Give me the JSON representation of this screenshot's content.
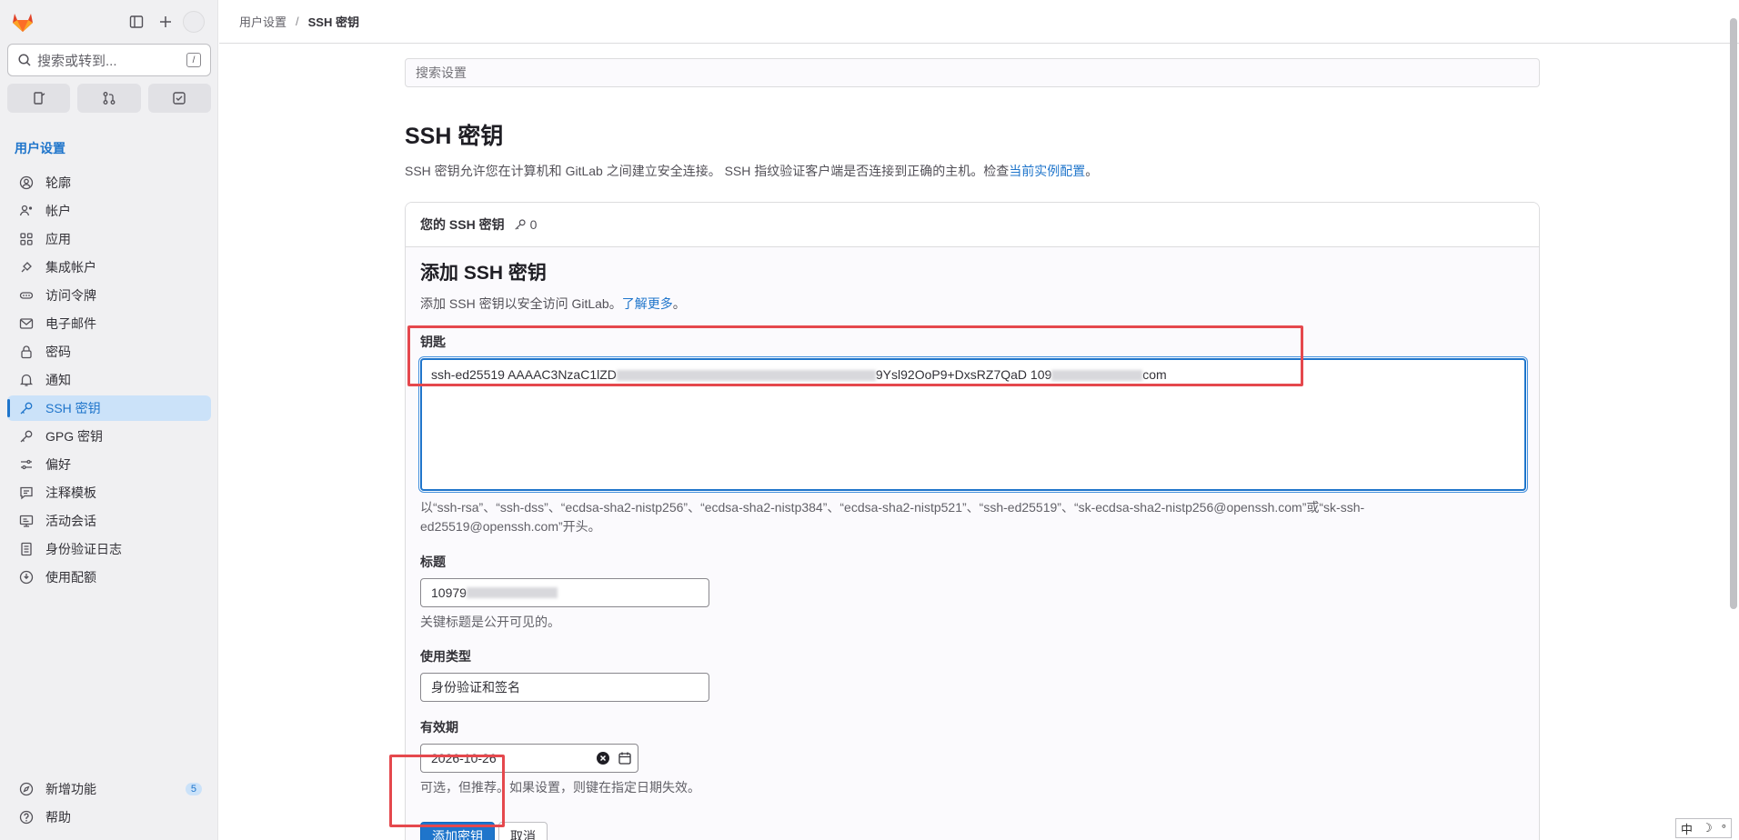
{
  "sidebar": {
    "search_placeholder": "搜索或转到...",
    "search_shortcut": "/",
    "section_title": "用户设置",
    "items": [
      {
        "label": "轮廓",
        "icon": "profile-icon"
      },
      {
        "label": "帐户",
        "icon": "account-icon"
      },
      {
        "label": "应用",
        "icon": "applications-icon"
      },
      {
        "label": "集成帐户",
        "icon": "chat-integration-icon"
      },
      {
        "label": "访问令牌",
        "icon": "token-icon"
      },
      {
        "label": "电子邮件",
        "icon": "mail-icon"
      },
      {
        "label": "密码",
        "icon": "lock-icon"
      },
      {
        "label": "通知",
        "icon": "notifications-icon"
      },
      {
        "label": "SSH 密钥",
        "icon": "key-icon",
        "active": true
      },
      {
        "label": "GPG 密钥",
        "icon": "key-icon"
      },
      {
        "label": "偏好",
        "icon": "preferences-icon"
      },
      {
        "label": "注释模板",
        "icon": "comment-templates-icon"
      },
      {
        "label": "活动会话",
        "icon": "sessions-icon"
      },
      {
        "label": "身份验证日志",
        "icon": "log-icon"
      },
      {
        "label": "使用配额",
        "icon": "quota-icon"
      }
    ],
    "whats_new": {
      "label": "新增功能",
      "badge": "5"
    },
    "help": {
      "label": "帮助"
    }
  },
  "breadcrumb": {
    "parent": "用户设置",
    "current": "SSH 密钥"
  },
  "settings_search_placeholder": "搜索设置",
  "page": {
    "title": "SSH 密钥",
    "desc_before": "SSH 密钥允许您在计算机和 GitLab 之间建立安全连接。 SSH 指纹验证客户端是否连接到正确的主机。检查",
    "desc_link": "当前实例配置",
    "desc_after": "。"
  },
  "card": {
    "header_title": "您的 SSH 密钥",
    "key_count": "0",
    "form_title": "添加 SSH 密钥",
    "form_desc": "添加 SSH 密钥以安全访问 GitLab。",
    "form_desc_link": "了解更多",
    "form_desc_after": "。",
    "key_label": "钥匙",
    "key_value_start": "ssh-ed25519 AAAAC3NzaC1lZD",
    "key_value_mid": "9Ysl92OoP9+DxsRZ7QaD 109",
    "key_value_end": "com",
    "key_hint": "以“ssh-rsa”、“ssh-dss”、“ecdsa-sha2-nistp256”、“ecdsa-sha2-nistp384”、“ecdsa-sha2-nistp521”、“ssh-ed25519”、“sk-ecdsa-sha2-nistp256@openssh.com”或“sk-ssh-ed25519@openssh.com”开头。",
    "title_label": "标题",
    "title_value": "10979",
    "title_hint": "关键标题是公开可见的。",
    "usage_label": "使用类型",
    "usage_value": "身份验证和签名",
    "expiry_label": "有效期",
    "expiry_value": "2026-10-26",
    "expiry_hint": "可选，但推荐。如果设置，则键在指定日期失效。",
    "add_button": "添加密钥",
    "cancel_button": "取消"
  },
  "ime": {
    "lang": "中",
    "moon": "☽",
    "dot": "°"
  }
}
